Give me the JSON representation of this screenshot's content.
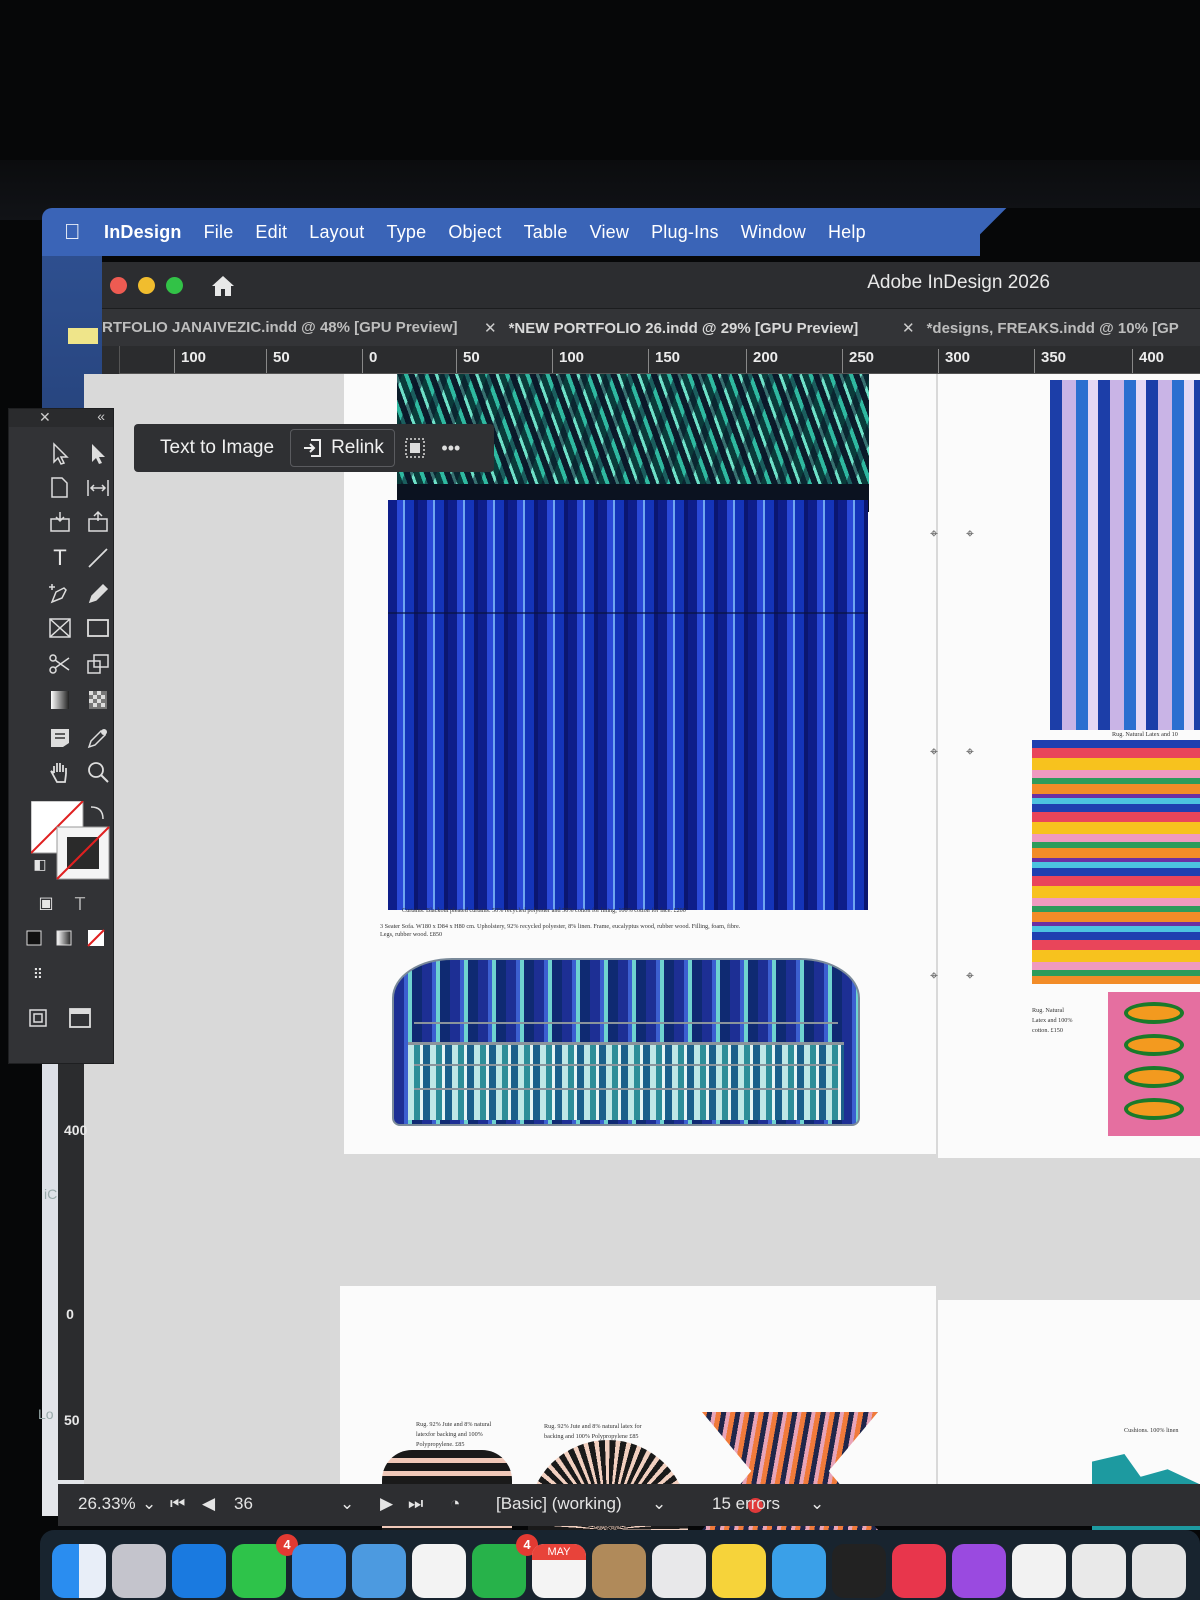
{
  "menubar": {
    "app_name": "InDesign",
    "items": [
      "File",
      "Edit",
      "Layout",
      "Type",
      "Object",
      "Table",
      "View",
      "Plug-Ins",
      "Window",
      "Help"
    ]
  },
  "window": {
    "title": "Adobe InDesign 2026"
  },
  "tabs": [
    {
      "label": "RTFOLIO JANAIVEZIC.indd @ 48% [GPU Preview]"
    },
    {
      "label": "*NEW PORTFOLIO 26.indd @ 29% [GPU Preview]"
    },
    {
      "label": "*designs, FREAKS.indd @ 10% [GP"
    }
  ],
  "ruler_h": [
    "100",
    "50",
    "0",
    "50",
    "100",
    "150",
    "200",
    "250",
    "300",
    "350",
    "400"
  ],
  "ruler_v": {
    "a": "400",
    "b": "0",
    "c": "50"
  },
  "context_bar": {
    "text_to_image": "Text to Image",
    "relink": "Relink",
    "more": "•••"
  },
  "captions": {
    "curtains": "Curtains. Blackout pleated curtains. 50% recycled polyester and 50% cotton for lining, 100% cotton for face. £200",
    "sofa_line1": "3 Seater Sofa. W180 x D84 x H80 cm. Upholstery, 92% recycled polyester, 8% linen. Frame, eucalyptus wood, rubber wood. Filling, foam, fibre.",
    "sofa_line2": "Legs, rubber wood. £850",
    "rug_right": "Rug. Natural Latex and 10",
    "rug_natural_1": "Rug. Natural",
    "rug_natural_2": "Latex and 100%",
    "rug_natural_3": "cotton. £150",
    "rug_jute_a1": "Rug. 92% Jute and 8% natural",
    "rug_jute_a2": "latexfor backing and 100%",
    "rug_jute_a3": "Polypropylene. £85",
    "rug_jute_b1": "Rug. 92% Jute and 8% natural latex for",
    "rug_jute_b2": "backing and 100% Polypropylene £85",
    "cushions": "Cushions. 100% linen"
  },
  "statusbar": {
    "zoom": "26.33%",
    "page": "36",
    "profile": "[Basic] (working)",
    "errors": "15 errors"
  },
  "desktop_labels": {
    "ic": "iC",
    "lo": "Lo"
  },
  "dock": {
    "badge_messages": "4",
    "badge_facetime": "4",
    "calendar_month": "MAY"
  },
  "colors": {
    "menubar": "#3a64b7",
    "window_chrome": "#2c2d30",
    "pasteboard": "#d9d9d9",
    "error": "#e0393a"
  }
}
